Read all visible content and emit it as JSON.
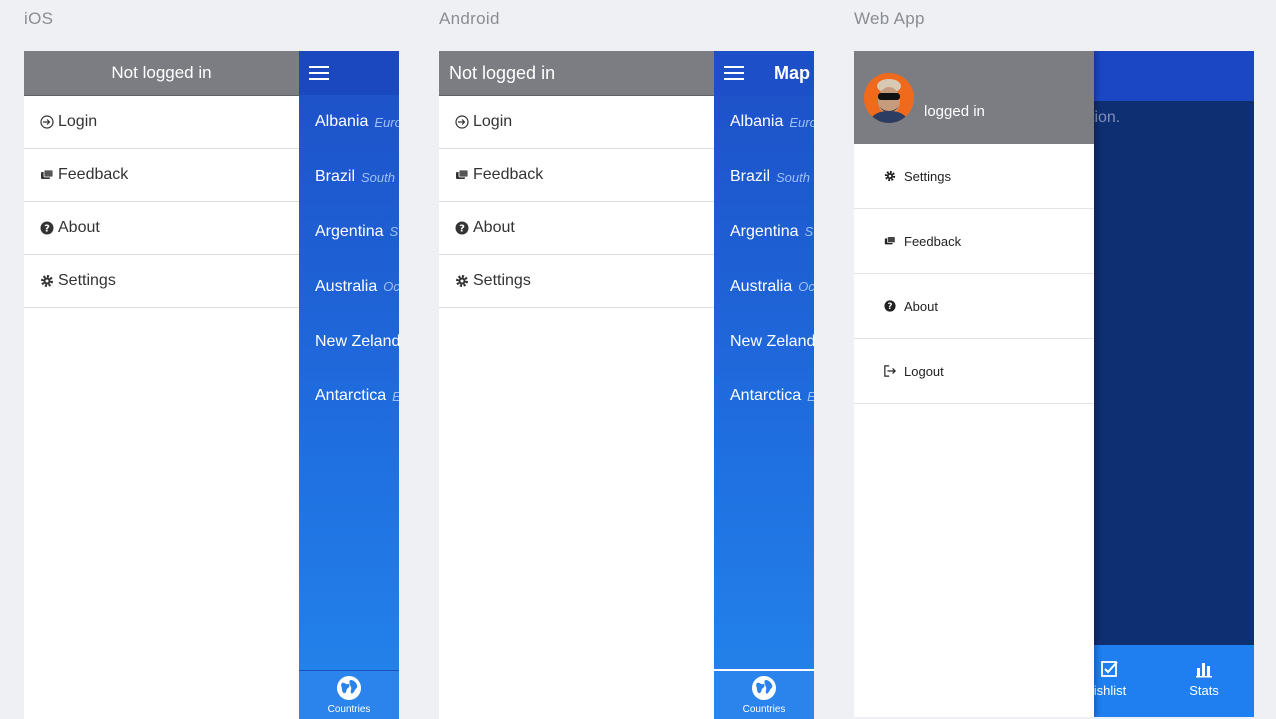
{
  "platforms": {
    "ios": "iOS",
    "android": "Android",
    "web": "Web App"
  },
  "ios": {
    "drawer_title": "Not logged in",
    "menu": [
      {
        "label": "Login",
        "icon": "login-icon"
      },
      {
        "label": "Feedback",
        "icon": "feedback-icon"
      },
      {
        "label": "About",
        "icon": "question-icon"
      },
      {
        "label": "Settings",
        "icon": "gear-icon"
      }
    ],
    "countries": [
      {
        "name": "Albania",
        "sub": "Euro"
      },
      {
        "name": "Brazil",
        "sub": "South"
      },
      {
        "name": "Argentina",
        "sub": "S"
      },
      {
        "name": "Australia",
        "sub": "Oc"
      },
      {
        "name": "New Zeland",
        "sub": ""
      },
      {
        "name": "Antarctica",
        "sub": "E"
      }
    ],
    "tab": "Countries"
  },
  "android": {
    "drawer_title": "Not logged in",
    "topbar_title": "Map",
    "menu": [
      {
        "label": "Login",
        "icon": "login-icon"
      },
      {
        "label": "Feedback",
        "icon": "feedback-icon"
      },
      {
        "label": "About",
        "icon": "question-icon"
      },
      {
        "label": "Settings",
        "icon": "gear-icon"
      }
    ],
    "countries": [
      {
        "name": "Albania",
        "sub": "Euro"
      },
      {
        "name": "Brazil",
        "sub": "South"
      },
      {
        "name": "Argentina",
        "sub": "S"
      },
      {
        "name": "Australia",
        "sub": "Oc"
      },
      {
        "name": "New Zeland",
        "sub": ""
      },
      {
        "name": "Antarctica",
        "sub": "E"
      }
    ],
    "tab": "Countries"
  },
  "web": {
    "user_status": "logged in",
    "background_text": "tion.",
    "menu": [
      {
        "label": "Settings",
        "icon": "gear-icon"
      },
      {
        "label": "Feedback",
        "icon": "feedback-icon"
      },
      {
        "label": "About",
        "icon": "question-icon"
      },
      {
        "label": "Logout",
        "icon": "logout-icon"
      }
    ],
    "tabs": [
      {
        "label": "ishlist",
        "icon": "checkbox-icon"
      },
      {
        "label": "Stats",
        "icon": "bar-chart-icon"
      }
    ]
  },
  "colors": {
    "drawer_header": "#7b7d83",
    "blue_dark": "#1b47bf",
    "blue_light": "#2a84ec",
    "avatar_bg": "#f06a1e"
  }
}
